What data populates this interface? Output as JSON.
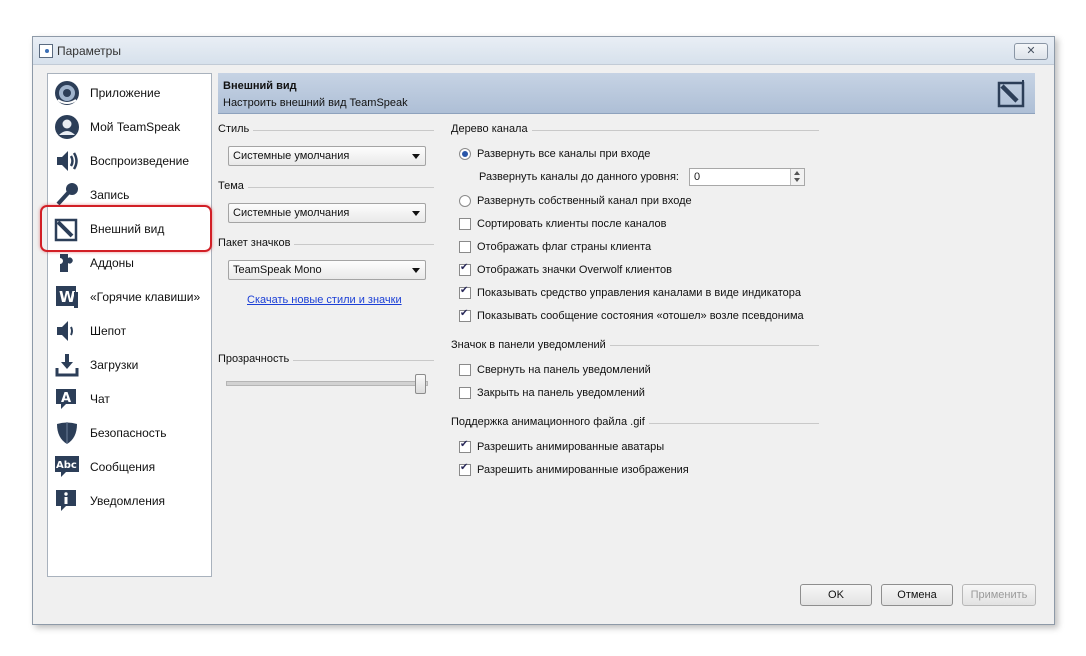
{
  "window": {
    "title": "Параметры",
    "close_label": "✕"
  },
  "sidebar": {
    "items": [
      {
        "label": "Приложение",
        "icon": "teamspeak-logo-icon"
      },
      {
        "label": "Мой TeamSpeak",
        "icon": "user-profile-icon"
      },
      {
        "label": "Воспроизведение",
        "icon": "speaker-icon"
      },
      {
        "label": "Запись",
        "icon": "microphone-icon"
      },
      {
        "label": "Внешний вид",
        "icon": "appearance-icon",
        "selected": true
      },
      {
        "label": "Аддоны",
        "icon": "puzzle-icon"
      },
      {
        "label": "«Горячие клавиши»",
        "icon": "keyboard-w-icon"
      },
      {
        "label": "Шепот",
        "icon": "whisper-icon"
      },
      {
        "label": "Загрузки",
        "icon": "download-icon"
      },
      {
        "label": "Чат",
        "icon": "chat-icon"
      },
      {
        "label": "Безопасность",
        "icon": "shield-icon"
      },
      {
        "label": "Сообщения",
        "icon": "abc-message-icon"
      },
      {
        "label": "Уведомления",
        "icon": "info-icon"
      }
    ]
  },
  "header": {
    "title": "Внешний вид",
    "subtitle": "Настроить внешний вид TeamSpeak"
  },
  "left": {
    "style_label": "Стиль",
    "style_value": "Системные умолчания",
    "theme_label": "Тема",
    "theme_value": "Системные умолчания",
    "iconpack_label": "Пакет значков",
    "iconpack_value": "TeamSpeak Mono",
    "download_link": "Скачать новые стили и значки",
    "transparency_label": "Прозрачность",
    "transparency_value": 1.0
  },
  "channel_tree": {
    "label": "Дерево канала",
    "expand_all": "Развернуть все каналы при входе",
    "expand_level_label": "Развернуть каналы до данного уровня:",
    "expand_level_value": "0",
    "expand_own": "Развернуть собственный канал при входе",
    "options": [
      {
        "label": "Сортировать клиенты после каналов",
        "checked": false
      },
      {
        "label": "Отображать флаг страны клиента",
        "checked": false
      },
      {
        "label": "Отображать значки Overwolf клиентов",
        "checked": true
      },
      {
        "label": "Показывать средство управления каналами в виде индикатора",
        "checked": true
      },
      {
        "label": "Показывать сообщение состояния «отошел» возле псевдонима",
        "checked": true
      }
    ]
  },
  "tray": {
    "label": "Значок в панели уведомлений",
    "options": [
      {
        "label": "Свернуть на панель уведомлений",
        "checked": false
      },
      {
        "label": "Закрыть на панель уведомлений",
        "checked": false
      }
    ]
  },
  "gif": {
    "label": "Поддержка анимационного файла .gif",
    "options": [
      {
        "label": "Разрешить анимированные аватары",
        "checked": true
      },
      {
        "label": "Разрешить анимированные изображения",
        "checked": true
      }
    ]
  },
  "buttons": {
    "ok": "OK",
    "cancel": "Отмена",
    "apply": "Применить"
  }
}
